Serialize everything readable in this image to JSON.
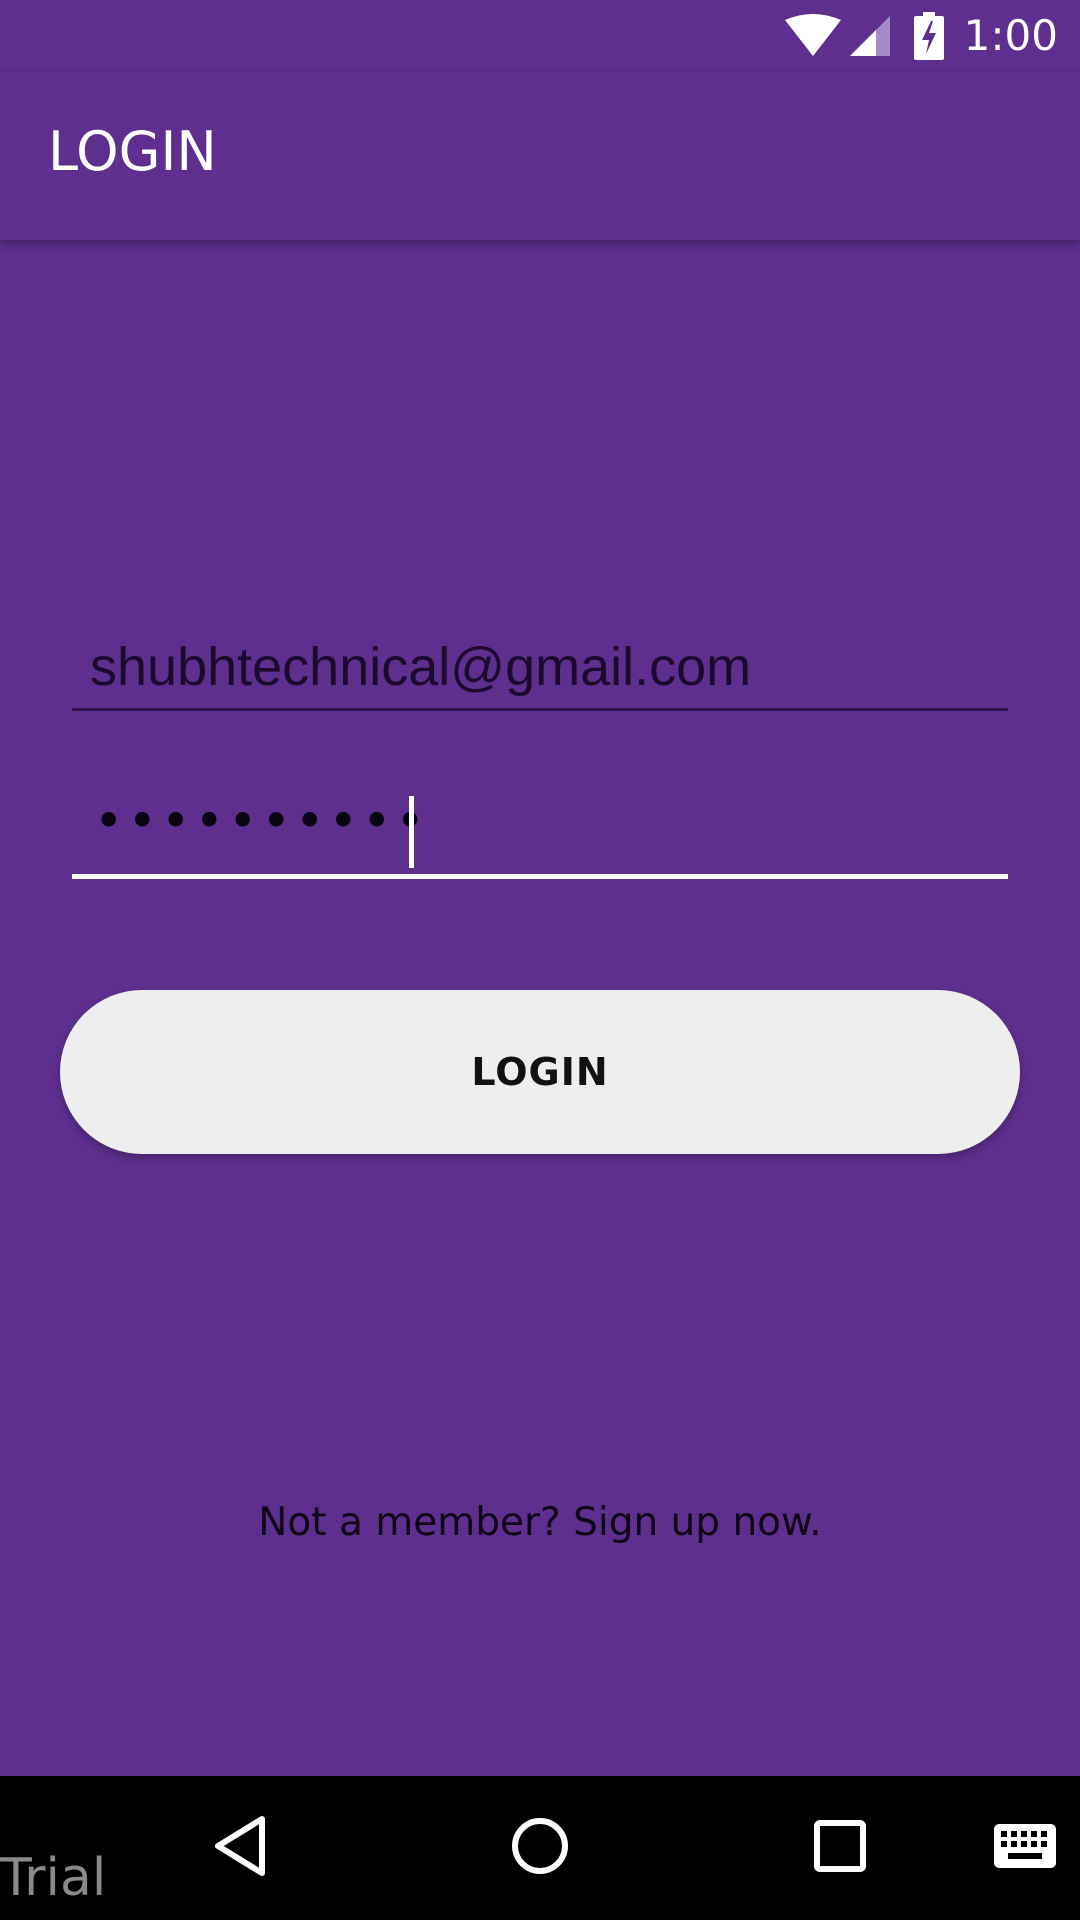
{
  "status_bar": {
    "time": "1:00",
    "icons": [
      "wifi-icon",
      "cellular-signal-icon",
      "battery-charging-icon"
    ]
  },
  "app_bar": {
    "title": "LOGIN"
  },
  "form": {
    "email_value": "shubhtechnical@gmail.com",
    "password_masked": "••••••••••",
    "login_label": "LOGIN",
    "signup_text": "Not a member? Sign up now."
  },
  "nav_bar": {
    "icons": [
      "back-icon",
      "home-icon",
      "recents-icon",
      "keyboard-icon"
    ]
  },
  "watermark": "Trial",
  "colors": {
    "primary": "#5e2f8e",
    "button": "#eeeeee",
    "nav": "#000000",
    "accent_underline": "#ffffff"
  }
}
